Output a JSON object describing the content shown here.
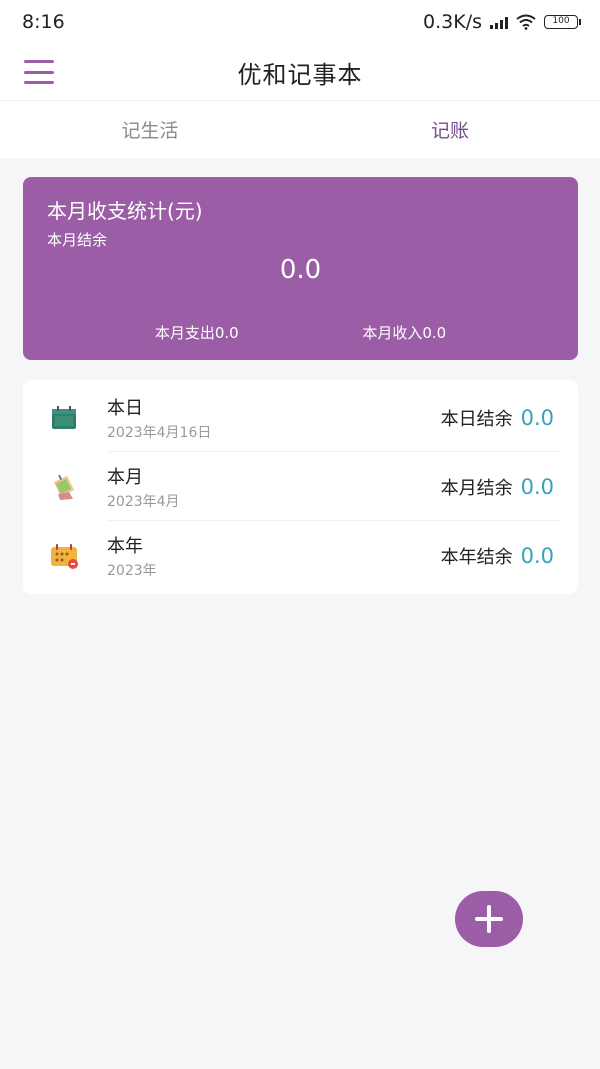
{
  "status_bar": {
    "time": "8:16",
    "network_speed": "0.3K/s",
    "battery": "100"
  },
  "app_bar": {
    "title": "优和记事本",
    "menu_icon": "menu-icon"
  },
  "tabs": [
    {
      "label": "记生活",
      "active": false
    },
    {
      "label": "记账",
      "active": true
    }
  ],
  "summary": {
    "title": "本月收支统计(元)",
    "balance_label": "本月结余",
    "balance_value": "0.0",
    "expense": "本月支出0.0",
    "income": "本月收入0.0"
  },
  "periods": [
    {
      "icon": "calendar-day-icon",
      "title": "本日",
      "date": "2023年4月16日",
      "balance_label": "本日结余",
      "balance_value": "0.0"
    },
    {
      "icon": "calendar-month-icon",
      "title": "本月",
      "date": "2023年4月",
      "balance_label": "本月结余",
      "balance_value": "0.0"
    },
    {
      "icon": "calendar-year-icon",
      "title": "本年",
      "date": "2023年",
      "balance_label": "本年结余",
      "balance_value": "0.0"
    }
  ],
  "fab": {
    "icon": "plus-icon"
  },
  "colors": {
    "accent": "#9b5ea6",
    "value": "#3ba0b8"
  }
}
